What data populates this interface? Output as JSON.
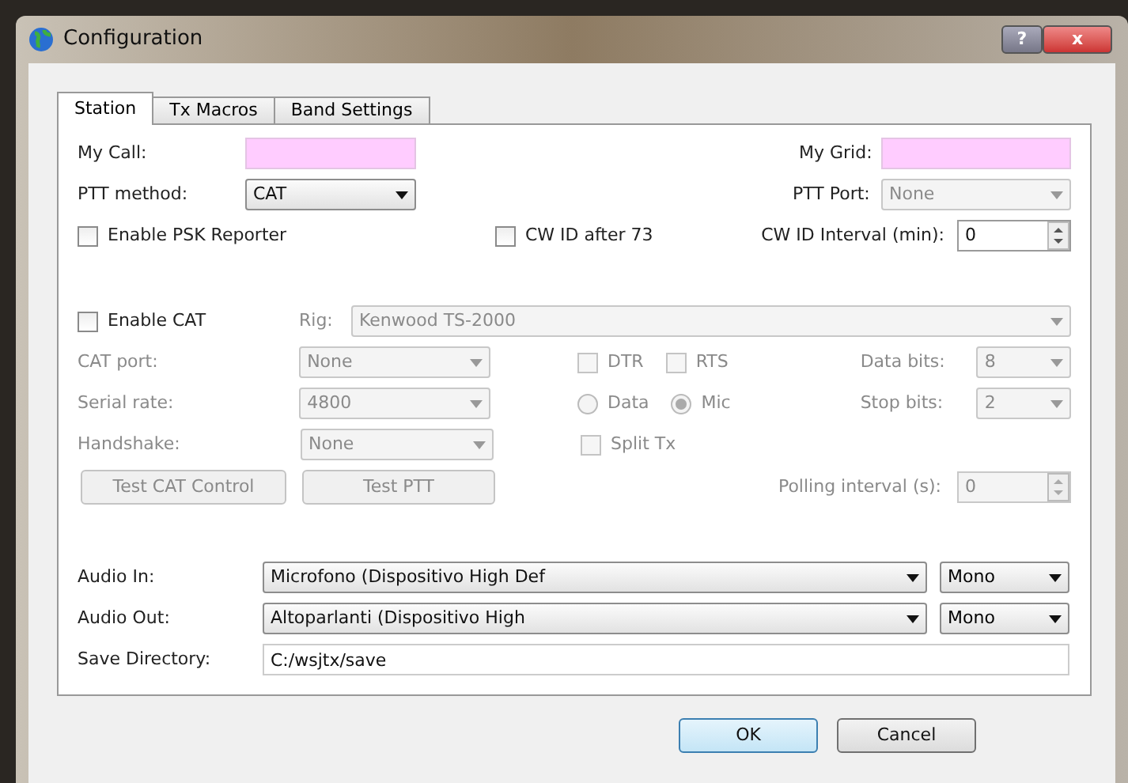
{
  "window": {
    "title": "Configuration",
    "buttons": [
      "?",
      "x"
    ]
  },
  "tabs": [
    {
      "label": "Station",
      "selected": true
    },
    {
      "label": "Tx Macros",
      "selected": false
    },
    {
      "label": "Band Settings",
      "selected": false
    }
  ],
  "station": {
    "my_call": {
      "label": "My Call:"
    },
    "my_grid": {
      "label": "My Grid:"
    },
    "ptt_method": {
      "label": "PTT method:",
      "value": "CAT",
      "disabled": false
    },
    "ptt_port": {
      "label": "PTT Port:",
      "value": "None",
      "disabled": true
    },
    "psk_reporter": {
      "label": "Enable PSK Reporter",
      "checked": false
    },
    "cw_id_after_73": {
      "label": "CW ID after 73",
      "checked": false
    },
    "cw_id_interval": {
      "label": "CW ID Interval (min):",
      "value": "0",
      "disabled": false
    },
    "enable_cat": {
      "label": "Enable CAT",
      "checked": false
    },
    "rig": {
      "label": "Rig:",
      "value": "Kenwood TS-2000",
      "disabled": true
    },
    "cat_port": {
      "label": "CAT port:",
      "value": "None",
      "disabled": true
    },
    "dtr": {
      "label": "DTR",
      "checked": false,
      "disabled": true
    },
    "rts": {
      "label": "RTS",
      "checked": false,
      "disabled": true
    },
    "data_bits": {
      "label": "Data bits:",
      "value": "8",
      "disabled": true
    },
    "serial_rate": {
      "label": "Serial rate:",
      "value": "4800",
      "disabled": true
    },
    "radios": [
      {
        "label": "Data",
        "selected": false,
        "disabled": true
      },
      {
        "label": "Mic",
        "selected": true,
        "disabled": true
      }
    ],
    "stop_bits": {
      "label": "Stop bits:",
      "value": "2",
      "disabled": true
    },
    "handshake": {
      "label": "Handshake:",
      "value": "None",
      "disabled": true
    },
    "split_tx": {
      "label": "Split Tx",
      "checked": false,
      "disabled": true
    },
    "test_cat": {
      "label": "Test CAT Control",
      "disabled": true
    },
    "test_ptt": {
      "label": "Test PTT",
      "disabled": true
    },
    "polling_interval": {
      "label": "Polling interval (s):",
      "value": "0",
      "disabled": true
    },
    "audio_in": {
      "label": "Audio In:",
      "value": "Microfono (Dispositivo High Def",
      "channel": "Mono",
      "disabled": false
    },
    "audio_out": {
      "label": "Audio Out:",
      "value": "Altoparlanti (Dispositivo High",
      "channel": "Mono",
      "disabled": false
    },
    "save_directory": {
      "label": "Save Directory:",
      "value": "C:/wsjtx/save"
    }
  },
  "buttons": [
    {
      "label": "OK",
      "default": true
    },
    {
      "label": "Cancel",
      "default": false
    }
  ]
}
